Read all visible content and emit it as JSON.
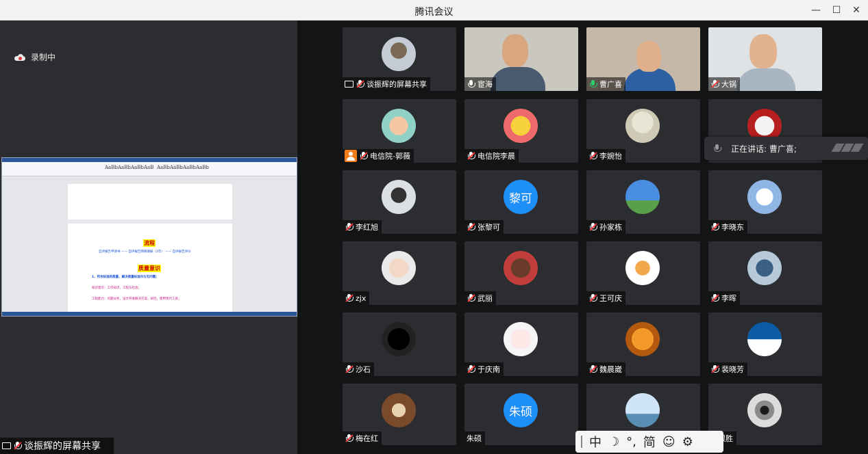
{
  "window": {
    "title": "腾讯会议",
    "minimize": "—",
    "maximize": "☐",
    "close": "✕"
  },
  "recording": {
    "label": "录制中",
    "icon": "cloud-record-icon"
  },
  "shared_document": {
    "heading_flow": "流程",
    "flow_line": "自评报告申请书 —— 自评报告网络填报（2年） —— 自评报告评价",
    "heading_quality": "质量意识",
    "line1": "1、符合标准的质量，解决质量标准内与无问题；",
    "line2": "知识意识：工作知识，工程与社会；",
    "line3": "工程能力：问题分析，设计开发解决方案，研究，使用现代工具；"
  },
  "share_label": "谈振辉的屏幕共享",
  "participants": [
    {
      "name": "谈振辉的屏幕共享",
      "kind": "avatar",
      "style": "photo-a",
      "mic": "muted",
      "badge": "screen"
    },
    {
      "name": "宦海",
      "kind": "video",
      "mic": "on"
    },
    {
      "name": "曹广喜",
      "kind": "video",
      "mic": "green"
    },
    {
      "name": "大锅",
      "kind": "video",
      "mic": "muted"
    },
    {
      "name": "电信院-郭薇",
      "kind": "avatar",
      "style": "photo-b",
      "mic": "muted",
      "badge": "user"
    },
    {
      "name": "电信院李晨",
      "kind": "avatar",
      "style": "photo-c",
      "mic": "muted"
    },
    {
      "name": "李婉怡",
      "kind": "avatar",
      "style": "photo-d",
      "mic": "muted"
    },
    {
      "name": "",
      "kind": "avatar",
      "style": "photo-e",
      "mic": "none"
    },
    {
      "name": "李红旭",
      "kind": "avatar",
      "style": "photo-f",
      "mic": "muted"
    },
    {
      "name": "张黎可",
      "kind": "text",
      "initials": "黎可",
      "mic": "muted"
    },
    {
      "name": "孙家栋",
      "kind": "avatar",
      "style": "photo-g",
      "mic": "muted"
    },
    {
      "name": "李晓东",
      "kind": "avatar",
      "style": "photo-h",
      "mic": "muted"
    },
    {
      "name": "zjx",
      "kind": "avatar",
      "style": "photo-i",
      "mic": "muted"
    },
    {
      "name": "武丽",
      "kind": "avatar",
      "style": "photo-j",
      "mic": "muted"
    },
    {
      "name": "王可庆",
      "kind": "avatar",
      "style": "photo-k",
      "mic": "muted"
    },
    {
      "name": "李晖",
      "kind": "avatar",
      "style": "photo-l",
      "mic": "muted"
    },
    {
      "name": "沙石",
      "kind": "avatar",
      "style": "photo-m",
      "mic": "muted"
    },
    {
      "name": "于庆南",
      "kind": "avatar",
      "style": "photo-n",
      "mic": "muted"
    },
    {
      "name": "魏晨崴",
      "kind": "avatar",
      "style": "photo-o",
      "mic": "muted"
    },
    {
      "name": "裴晓芳",
      "kind": "avatar",
      "style": "photo-p",
      "mic": "muted"
    },
    {
      "name": "梅在红",
      "kind": "avatar",
      "style": "photo-q",
      "mic": "muted"
    },
    {
      "name": "朱硕",
      "kind": "text",
      "initials": "朱硕",
      "mic": "none"
    },
    {
      "name": "",
      "kind": "avatar",
      "style": "photo-r",
      "mic": "none"
    },
    {
      "name": "张银胜",
      "kind": "avatar",
      "style": "photo-s",
      "mic": "none"
    }
  ],
  "speaking": {
    "label": "正在讲话: 曹广喜;"
  },
  "ime": {
    "lang": "中",
    "moon": "☽",
    "punct": "°,",
    "simplified": "简",
    "emoji": "☺",
    "settings": "⚙"
  }
}
